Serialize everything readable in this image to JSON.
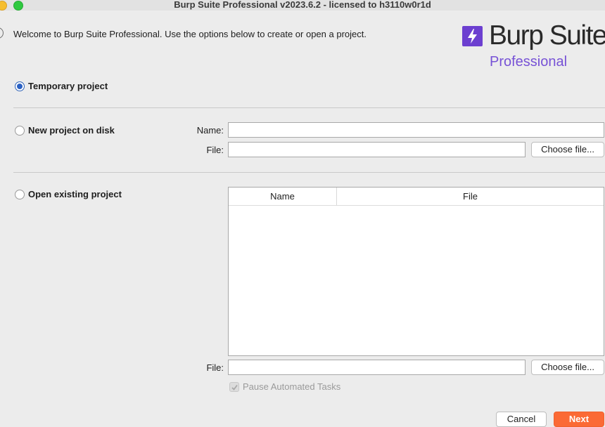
{
  "window": {
    "title": "Burp Suite Professional v2023.6.2 - licensed to h3110w0r1d"
  },
  "welcome_message": "Welcome to Burp Suite Professional. Use the options below to create or open a project.",
  "logo": {
    "name": "Burp Suite",
    "edition": "Professional",
    "brand_color": "#6c3fd0"
  },
  "options": {
    "temporary": {
      "label": "Temporary project",
      "selected": true
    },
    "new_on_disk": {
      "label": "New project on disk",
      "selected": false,
      "name_label": "Name:",
      "name_value": "",
      "file_label": "File:",
      "file_value": "",
      "choose_file_label": "Choose file..."
    },
    "open_existing": {
      "label": "Open existing project",
      "selected": false,
      "table_columns": [
        "Name",
        "File"
      ],
      "table_rows": [],
      "file_label": "File:",
      "file_value": "",
      "choose_file_label": "Choose file..."
    }
  },
  "pause_automated_tasks": {
    "label": "Pause Automated Tasks",
    "checked": true,
    "enabled": false
  },
  "buttons": {
    "cancel": "Cancel",
    "next": "Next"
  },
  "colors": {
    "accent_next": "#fb6a35",
    "radio_selected": "#2b61c4"
  }
}
